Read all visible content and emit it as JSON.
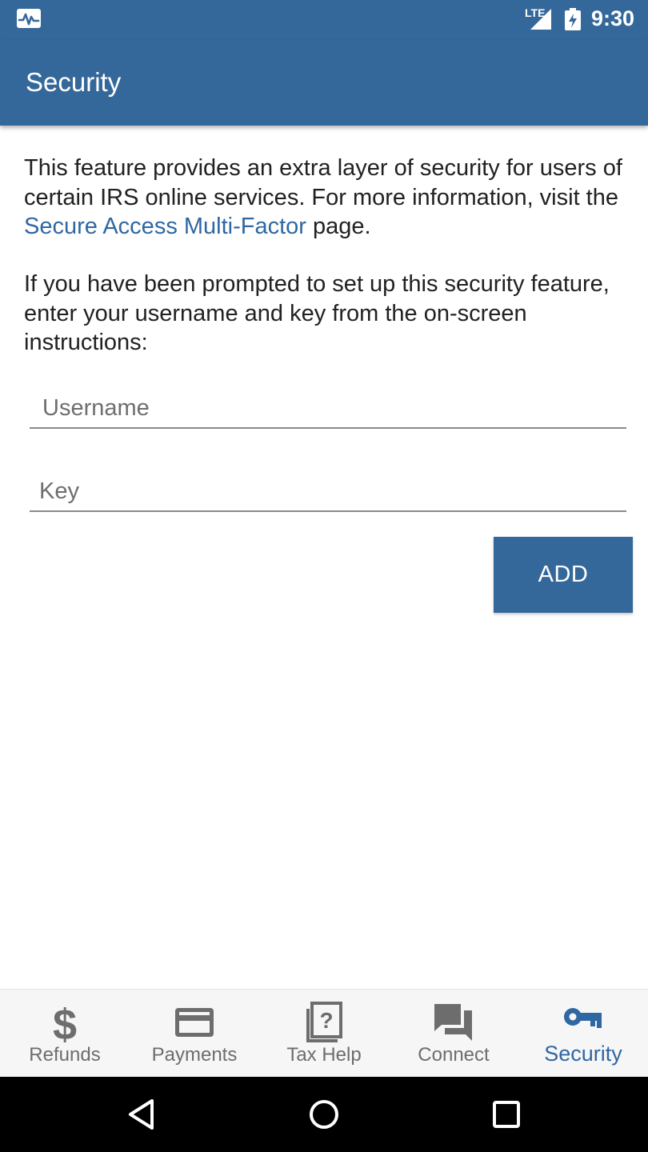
{
  "status_bar": {
    "app_icon": "activity-monitor-icon",
    "network_label": "LTE",
    "signal_icon": "signal-icon",
    "battery_icon": "battery-charging-icon",
    "time": "9:30"
  },
  "app_bar": {
    "title": "Security"
  },
  "content": {
    "intro_before_link": "This feature provides an extra layer of security for users of certain IRS online services. For more information, visit the ",
    "intro_link": "Secure Access Multi-Factor",
    "intro_after_link": " page.",
    "instructions": "If you have been prompted to set up this security feature, enter your username and key from the on-screen instructions:"
  },
  "form": {
    "username_placeholder": "Username",
    "username_value": "",
    "key_placeholder": "Key",
    "key_value": "",
    "add_label": "ADD"
  },
  "bottom_nav": {
    "items": [
      {
        "label": "Refunds",
        "icon": "dollar-icon"
      },
      {
        "label": "Payments",
        "icon": "credit-card-icon"
      },
      {
        "label": "Tax Help",
        "icon": "help-document-icon"
      },
      {
        "label": "Connect",
        "icon": "chat-icon"
      },
      {
        "label": "Security",
        "icon": "key-icon"
      }
    ],
    "active_index": 4
  },
  "system_nav": {
    "back_icon": "back-triangle-icon",
    "home_icon": "home-circle-icon",
    "recents_icon": "recents-square-icon"
  },
  "colors": {
    "primary": "#35689a",
    "link": "#2f67a2",
    "inactive": "#6d6d6d"
  }
}
